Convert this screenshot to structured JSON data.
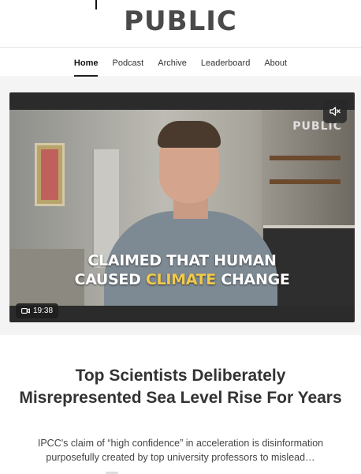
{
  "site": {
    "logo": "PUBLIC"
  },
  "nav": {
    "items": [
      {
        "label": "Home",
        "active": true
      },
      {
        "label": "Podcast"
      },
      {
        "label": "Archive"
      },
      {
        "label": "Leaderboard"
      },
      {
        "label": "About"
      }
    ]
  },
  "video": {
    "watermark": "PUBLIC",
    "caption_line1": "CLAIMED THAT HUMAN",
    "caption_line2_pre": "CAUSED ",
    "caption_line2_highlight": "CLIMATE",
    "caption_line2_post": " CHANGE",
    "highlight_color": "#f2c94c",
    "duration": "19:38",
    "mute_icon": "speaker-muted-icon",
    "duration_icon": "video-camera-icon"
  },
  "article": {
    "headline": "Top Scientists Deliberately Misrepresented Sea Level Rise For Years",
    "subtitle": "IPCC's claim of “high confidence” in acceleration is disinformation purposefully created by top university professors to mislead…"
  }
}
